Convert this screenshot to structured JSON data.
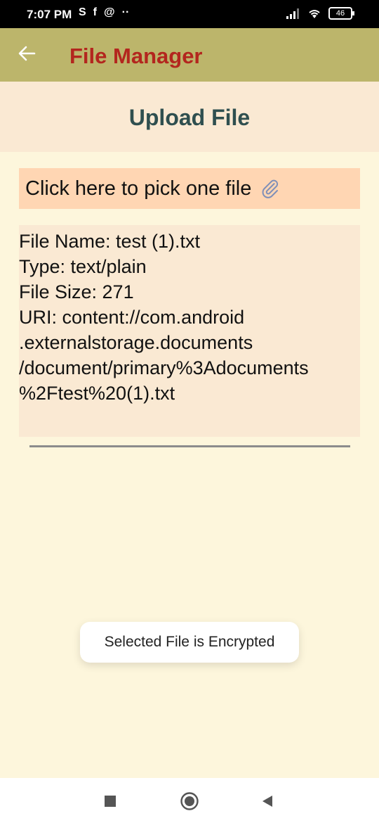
{
  "status_bar": {
    "time": "7:07 PM",
    "left_icons": [
      "S",
      "f",
      "@",
      "··"
    ],
    "battery": "46"
  },
  "app_bar": {
    "title": "File Manager",
    "back_icon": "arrow-left-icon",
    "background": "#bcb56b",
    "title_color": "#b3261e"
  },
  "page": {
    "title": "Upload File"
  },
  "picker": {
    "label": "Click here to pick one file",
    "icon": "paperclip-icon"
  },
  "file_info": {
    "lines": [
      "File Name: test (1).txt",
      "Type: text/plain",
      "File Size: 271",
      "URI: content://com.android",
      ".externalstorage.documents",
      "/document/primary%3Adocuments",
      "%2Ftest%20(1).txt"
    ]
  },
  "toast": {
    "message": "Selected File is Encrypted"
  },
  "nav_bar": {
    "items": [
      "recents-square-icon",
      "home-circle-icon",
      "back-triangle-icon"
    ]
  }
}
